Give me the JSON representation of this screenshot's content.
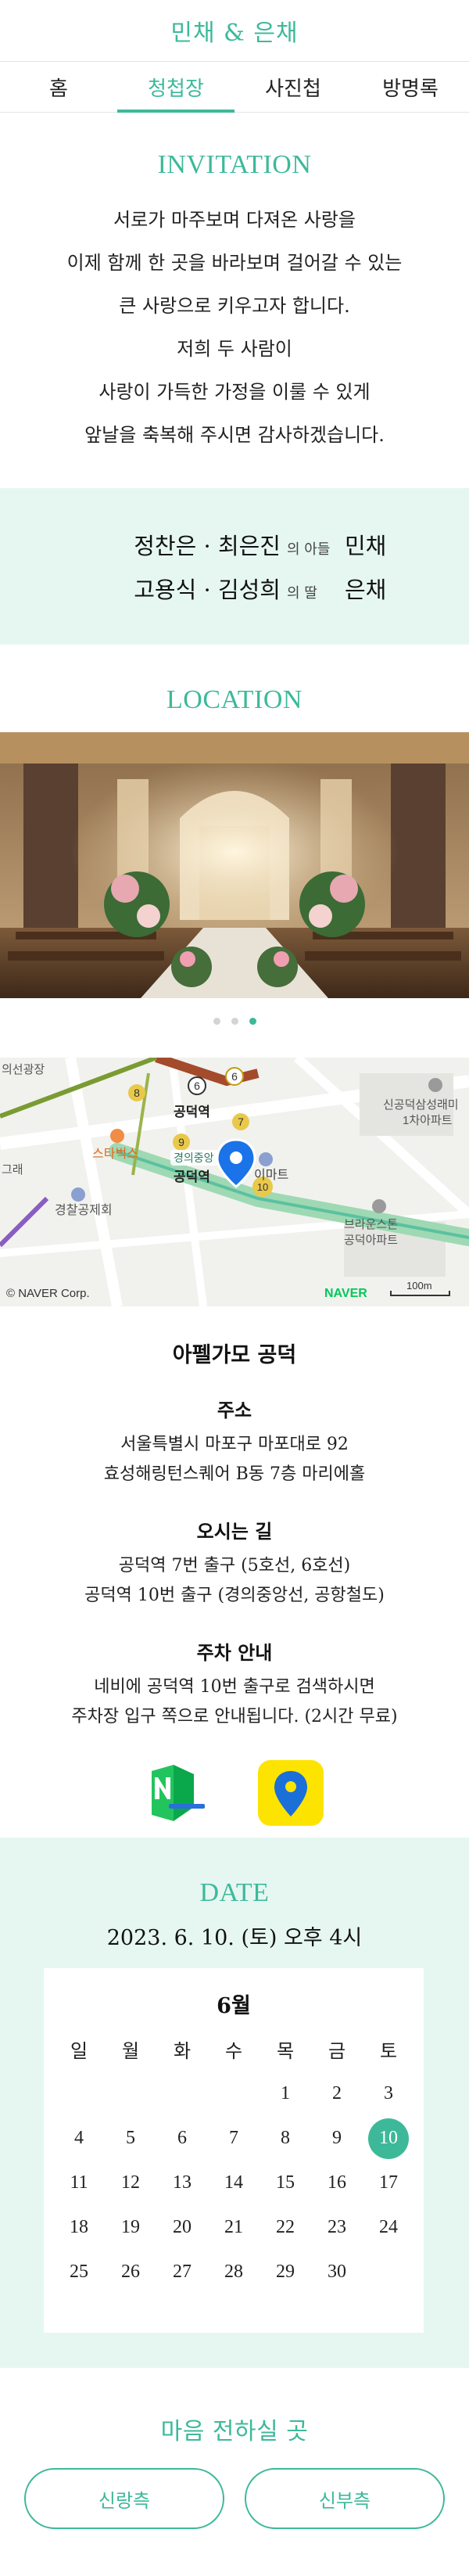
{
  "header": {
    "title": "민채 & 은채"
  },
  "tabs": [
    {
      "label": "홈"
    },
    {
      "label": "청첩장"
    },
    {
      "label": "사진첩"
    },
    {
      "label": "방명록"
    }
  ],
  "invitation": {
    "title": "INVITATION",
    "lines": [
      "서로가 마주보며 다져온 사랑을",
      "이제 함께 한 곳을 바라보며 걸어갈 수 있는",
      "큰 사랑으로 키우고자 합니다.",
      "저희 두 사람이",
      "사랑이 가득한 가정을 이룰 수 있게",
      "앞날을 축복해 주시면 감사하겠습니다."
    ],
    "families": [
      {
        "parents": "정찬은 · 최은진",
        "relation": "의 아들",
        "child": "민채"
      },
      {
        "parents": "고용식 · 김성희",
        "relation": "의 딸",
        "child": "은채"
      }
    ]
  },
  "location": {
    "title": "LOCATION",
    "venue_name": "아펠가모 공덕",
    "address_head": "주소",
    "address_lines": [
      "서울특별시 마포구 마포대로 92",
      "효성해링턴스퀘어 B동 7층 마리에홀"
    ],
    "directions_head": "오시는 길",
    "directions_lines": [
      "공덕역 7번 출구 (5호선, 6호선)",
      "공덕역 10번 출구 (경의중앙선, 공항철도)"
    ],
    "parking_head": "주차 안내",
    "parking_lines": [
      "네비에 공덕역 10번 출구로 검색하시면",
      "주차장 입구 쪽으로 안내됩니다. (2시간 무료)"
    ],
    "map": {
      "labels": {
        "station_top": "공덕역",
        "station_bottom": "공덕역",
        "gyeongui": "경의중앙",
        "starbucks": "스타벅스",
        "emart": "이마트",
        "police": "경찰공제회",
        "apt1": "신공덕삼성래미",
        "apt1b": "1차아파트",
        "apt2": "브라운스톤",
        "apt2b": "공덕아파트",
        "plaza": "의선광장",
        "grae": "그래",
        "copyright": "© NAVER Corp.",
        "naver": "NAVER",
        "scale": "100m",
        "line6a": "6",
        "line6b": "6",
        "line7": "7",
        "line8": "8",
        "line9": "9",
        "line10": "10"
      }
    }
  },
  "date": {
    "title": "DATE",
    "text": "2023. 6. 10. (토) 오후 4시",
    "month": "6월",
    "weekdays": [
      "일",
      "월",
      "화",
      "수",
      "목",
      "금",
      "토"
    ],
    "days": [
      "",
      "",
      "",
      "",
      "1",
      "2",
      "3",
      "4",
      "5",
      "6",
      "7",
      "8",
      "9",
      "10",
      "11",
      "12",
      "13",
      "14",
      "15",
      "16",
      "17",
      "18",
      "19",
      "20",
      "21",
      "22",
      "23",
      "24",
      "25",
      "26",
      "27",
      "28",
      "29",
      "30",
      ""
    ],
    "selected_day": "10"
  },
  "account": {
    "title": "마음 전하실 곳",
    "groom_label": "신랑측",
    "bride_label": "신부측"
  },
  "colors": {
    "accent": "#3db99a",
    "mint_bg": "#e6f7f2"
  }
}
